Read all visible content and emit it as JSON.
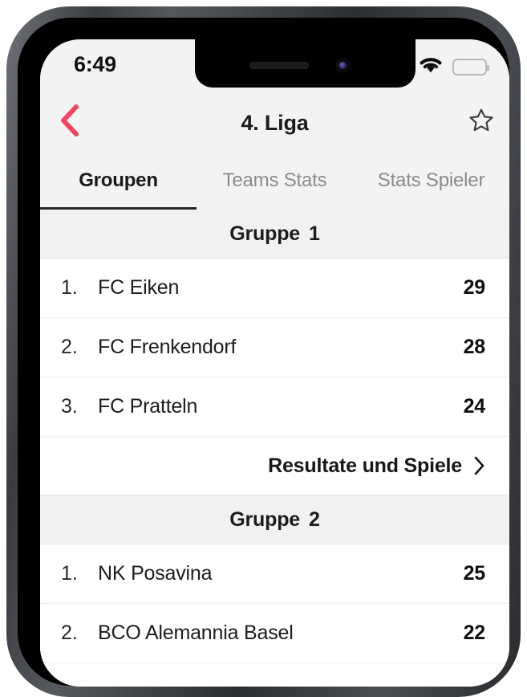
{
  "status_bar": {
    "time": "6:49",
    "signal_icon": "signal-dots-icon",
    "wifi_icon": "wifi-icon",
    "battery_icon": "battery-full-icon"
  },
  "nav_bar": {
    "back_icon": "chevron-left-icon",
    "title": "4. Liga",
    "favorite_icon": "star-outline-icon"
  },
  "tabs": [
    {
      "label": "Groupen",
      "active": true
    },
    {
      "label": "Teams Stats",
      "active": false
    },
    {
      "label": "Stats Spieler",
      "active": false
    }
  ],
  "groups": [
    {
      "title": "Gruppe",
      "number": "1",
      "teams": [
        {
          "rank": "1.",
          "name": "FC Eiken",
          "points": "29"
        },
        {
          "rank": "2.",
          "name": "FC Frenkendorf",
          "points": "28"
        },
        {
          "rank": "3.",
          "name": "FC Pratteln",
          "points": "24"
        }
      ],
      "results_link": "Resultate und Spiele",
      "results_chevron_icon": "chevron-right-icon"
    },
    {
      "title": "Gruppe",
      "number": "2",
      "teams": [
        {
          "rank": "1.",
          "name": "NK Posavina",
          "points": "25"
        },
        {
          "rank": "2.",
          "name": "BCO Alemannia Basel",
          "points": "22"
        }
      ]
    }
  ],
  "colors": {
    "accent_red": "#f5455c",
    "active_tab": "#1a1a1c",
    "inactive_tab": "#8b8b8e",
    "header_band": "#f1f1f1",
    "chrome_background": "#f3f3f3"
  }
}
